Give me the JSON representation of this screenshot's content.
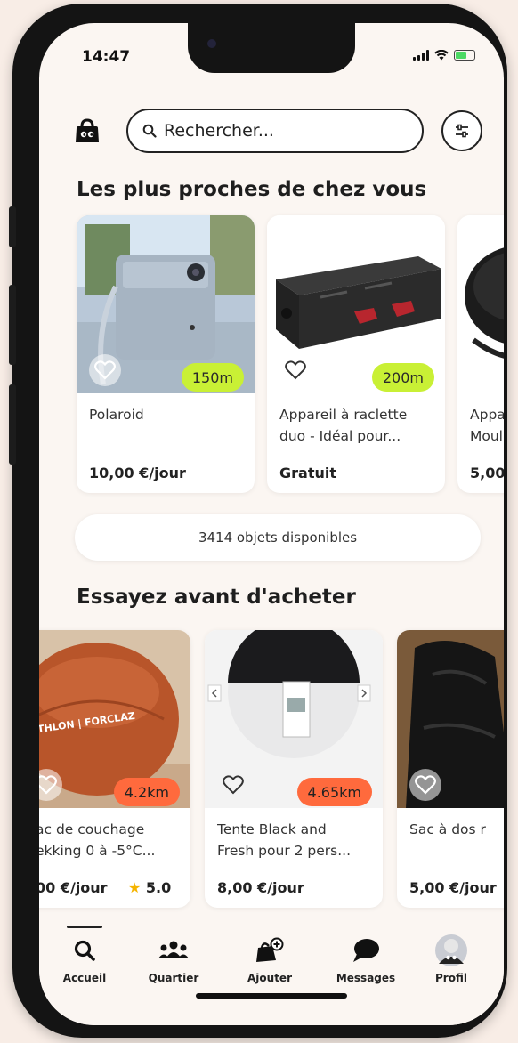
{
  "status_bar": {
    "time": "14:47"
  },
  "header": {
    "search_placeholder": "Rechercher..."
  },
  "section_nearby": {
    "title": "Les plus proches de chez vous",
    "items": [
      {
        "title_line1": "Polaroid",
        "title_line2": "",
        "price": "10,00 €/jour",
        "distance": "150m"
      },
      {
        "title_line1": "Appareil à raclette",
        "title_line2": "duo - Idéal pour...",
        "price": "Gratuit",
        "distance": "200m"
      },
      {
        "title_line1": "Appa",
        "title_line2": "Moul",
        "price": "5,00"
      }
    ],
    "available_count": "3414 objets disponibles"
  },
  "section_try": {
    "title": "Essayez avant d'acheter",
    "items": [
      {
        "title_line1": "ac de couchage",
        "title_line2": "ekking 0 à -5°C...",
        "price": "00 €/jour",
        "rating": "5.0",
        "distance": "4.2km",
        "image_text": "ATHLON | FORCLAZ"
      },
      {
        "title_line1": "Tente Black and",
        "title_line2": "Fresh pour 2 pers...",
        "price": "8,00 €/jour",
        "distance": "4.65km"
      },
      {
        "title_line1": "Sac à dos r",
        "title_line2": "",
        "price": "5,00 €/jour"
      }
    ]
  },
  "tabbar": {
    "tabs": [
      {
        "label": "Accueil",
        "icon": "search-icon"
      },
      {
        "label": "Quartier",
        "icon": "people-icon"
      },
      {
        "label": "Ajouter",
        "icon": "bag-add-icon"
      },
      {
        "label": "Messages",
        "icon": "chat-bubble-icon"
      },
      {
        "label": "Profil",
        "icon": "avatar"
      }
    ]
  },
  "colors": {
    "green_badge": "#c9f035",
    "orange_badge": "#ff6a3d",
    "background": "#fbf6f2"
  }
}
